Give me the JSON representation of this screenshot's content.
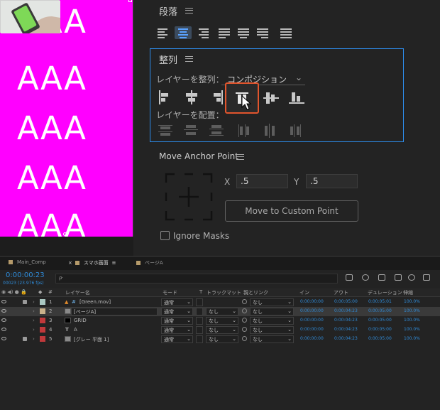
{
  "viewer": {
    "aaa_text": "AAA",
    "bg_color": "#ff00ff"
  },
  "paragraph": {
    "title": "段落",
    "menu_icon": "hamburger-icon"
  },
  "align": {
    "title": "整列",
    "align_layers_label": "レイヤーを整列：",
    "align_to_value": "コンポジション",
    "distribute_label": "レイヤーを配置：",
    "highlight_color": "#e2552d"
  },
  "anchor": {
    "title": "Move Anchor Point",
    "x_label": "X",
    "x_value": ".5",
    "y_label": "Y",
    "y_value": ".5",
    "move_button": "Move to Custom Point",
    "ignore_masks": "Ignore Masks"
  },
  "tabs": [
    {
      "label": "Main_Comp"
    },
    {
      "label": "スマホ画面"
    },
    {
      "label": "ページA"
    }
  ],
  "timeline": {
    "timecode": "0:00:00:23",
    "frame_info": "00023 (23.976 fps)",
    "search_placeholder": "ρ·"
  },
  "columns": {
    "layer_name": "レイヤー名",
    "mode": "モード",
    "t": "T",
    "track_matte": "トラックマット",
    "parent": "親とリンク",
    "in": "イン",
    "out": "アウト",
    "duration": "デュレーション",
    "stretch": "伸縮"
  },
  "layers": [
    {
      "num": "1",
      "name": "[Green.mov]",
      "mode": "通常",
      "matte": "",
      "parent": "なし",
      "in": "0:00:00:00",
      "out": "0:00:05:00",
      "dur": "0:00:05:01",
      "stretch": "100.0%",
      "color": "#a9c7c1"
    },
    {
      "num": "2",
      "name": "[ページA]",
      "mode": "通常",
      "matte": "なし",
      "parent": "なし",
      "in": "0:00:00:00",
      "out": "0:00:04:23",
      "dur": "0:00:05:00",
      "stretch": "100.0%",
      "color": "#c9b18a"
    },
    {
      "num": "3",
      "name": "GRID",
      "mode": "通常",
      "matte": "なし",
      "parent": "なし",
      "in": "0:00:00:00",
      "out": "0:00:04:23",
      "dur": "0:00:05:00",
      "stretch": "100.0%",
      "color": "#c0393b"
    },
    {
      "num": "4",
      "name": "A",
      "mode": "通常",
      "matte": "なし",
      "parent": "なし",
      "in": "0:00:00:00",
      "out": "0:00:04:23",
      "dur": "0:00:05:00",
      "stretch": "100.0%",
      "color": "#c0393b"
    },
    {
      "num": "5",
      "name": "[グレー 平面 1]",
      "mode": "通常",
      "matte": "なし",
      "parent": "なし",
      "in": "0:00:00:00",
      "out": "0:00:04:23",
      "dur": "0:00:05:00",
      "stretch": "100.0%",
      "color": "#c0393b"
    }
  ]
}
